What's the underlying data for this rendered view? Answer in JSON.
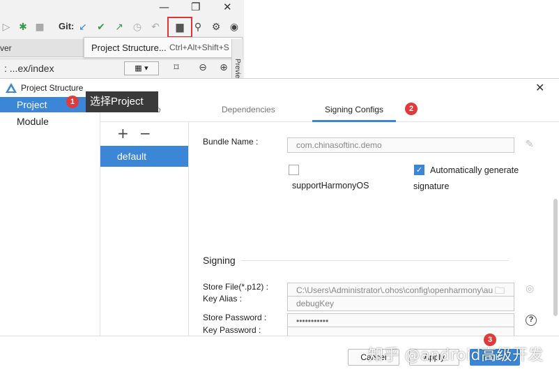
{
  "ide": {
    "git_label": "Git:",
    "tooltip": {
      "title": "Project Structure...",
      "shortcut": "Ctrl+Alt+Shift+S"
    },
    "left_tab": "ver",
    "path": ": ...ex/index",
    "preview_tab": "Previe"
  },
  "dialog": {
    "title": "Project Structure",
    "nav": [
      {
        "label": "Project"
      },
      {
        "label": "Module"
      }
    ],
    "callout": "选择Project",
    "badges": [
      "1",
      "2",
      "3"
    ],
    "tabs": [
      {
        "label": "Basic Info"
      },
      {
        "label": "Dependencies"
      },
      {
        "label": "Signing Configs"
      }
    ],
    "configs": [
      "default"
    ],
    "form": {
      "bundle_name_label": "Bundle Name",
      "bundle_name_value": "com.chinasoftinc.demo",
      "support_harmony_label": "supportHarmonyOS",
      "support_harmony_checked": false,
      "auto_generate_label": "Automatically generate",
      "auto_generate_label2": "signature",
      "auto_generate_checked": true,
      "signing_section": "Signing",
      "store_file_label": "Store File(*.p12)",
      "store_file_value": "C:\\Users\\Administrator\\.ohos\\config\\openharmony\\au",
      "store_password_label": "Store Password",
      "store_password_value": "•••••••••••",
      "key_alias_label": "Key Alias",
      "key_alias_value": "debugKey",
      "key_password_label": "Key Password"
    },
    "buttons": {
      "cancel": "Cancel",
      "apply": "Apply",
      "ok": "OK"
    }
  },
  "watermark": "知乎 @android高级开发",
  "colors": {
    "accent": "#3b86d6",
    "badge": "#e03a3a",
    "highlight": "#e0343a"
  }
}
